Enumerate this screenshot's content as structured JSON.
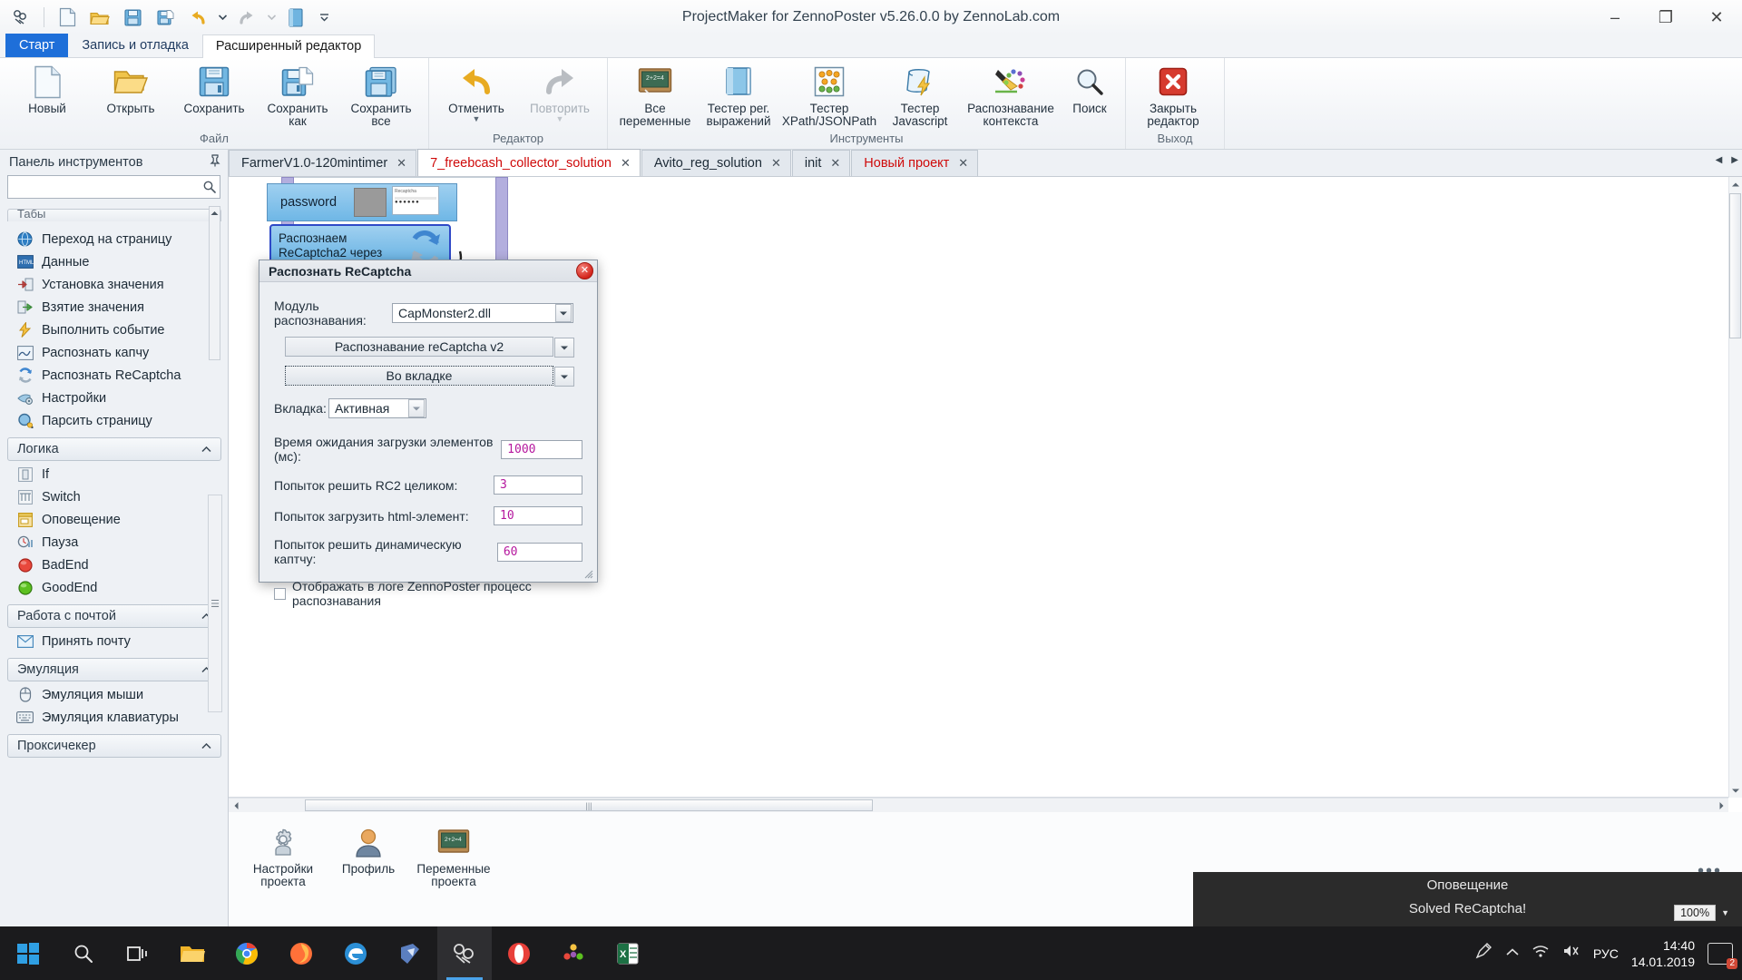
{
  "window": {
    "title": "ProjectMaker for ZennoPoster v5.26.0.0 by ZennoLab.com",
    "minimize": "–",
    "maximize": "❐",
    "close": "✕"
  },
  "quick_access": {
    "icons": [
      "zenno-logo-icon",
      "new-file-icon",
      "open-folder-icon",
      "save-icon",
      "save-as-icon",
      "undo-icon",
      "undo-dropdown-icon",
      "redo-icon",
      "redo-dropdown-icon",
      "book-icon",
      "customize-qat-icon"
    ]
  },
  "ribbon_tabs": [
    {
      "label": "Старт",
      "state": "active-blue"
    },
    {
      "label": "Запись и отладка",
      "state": "normal"
    },
    {
      "label": "Расширенный редактор",
      "state": "active-white"
    }
  ],
  "ribbon_groups": [
    {
      "title": "Файл",
      "items": [
        {
          "label": "Новый",
          "icon": "new-document-icon"
        },
        {
          "label": "Открыть",
          "icon": "open-folder-icon"
        },
        {
          "label": "Сохранить",
          "icon": "floppy-save-icon"
        },
        {
          "label": "Сохранить\nкак",
          "icon": "floppy-save-as-icon"
        },
        {
          "label": "Сохранить\nвсе",
          "icon": "floppy-save-all-icon"
        }
      ]
    },
    {
      "title": "Редактор",
      "items": [
        {
          "label": "Отменить",
          "icon": "undo-arrow-icon",
          "caret": "▼"
        },
        {
          "label": "Повторить",
          "icon": "redo-arrow-icon",
          "caret": "▼",
          "disabled": true
        }
      ]
    },
    {
      "title": "Инструменты",
      "items": [
        {
          "label": "Все\nпеременные",
          "icon": "blackboard-icon"
        },
        {
          "label": "Тестер рег.\nвыражений",
          "icon": "blue-book-icon"
        },
        {
          "label": "Тестер\nXPath/JSONPath",
          "icon": "dots-grid-icon"
        },
        {
          "label": "Тестер\nJavascript",
          "icon": "script-lightning-icon"
        },
        {
          "label": "Распознавание\nконтекста",
          "icon": "pencil-colors-icon"
        },
        {
          "label": "Поиск",
          "icon": "magnifier-icon"
        }
      ]
    },
    {
      "title": "Выход",
      "items": [
        {
          "label": "Закрыть\nредактор",
          "icon": "red-x-icon"
        }
      ]
    }
  ],
  "sidebar": {
    "title": "Панель инструментов",
    "pin_icon": "pin-icon",
    "search": {
      "value": "",
      "placeholder": "",
      "icon": "search-icon"
    },
    "clipped_group": "Табы",
    "groups": [
      {
        "label": null,
        "items": [
          {
            "label": "Переход на страницу",
            "icon": "globe-icon"
          },
          {
            "label": "Данные",
            "icon": "html-icon"
          },
          {
            "label": "Установка значения",
            "icon": "set-value-icon"
          },
          {
            "label": "Взятие значения",
            "icon": "get-value-icon"
          },
          {
            "label": "Выполнить событие",
            "icon": "lightning-icon"
          },
          {
            "label": "Распознать капчу",
            "icon": "captcha-icon"
          },
          {
            "label": "Распознать ReCaptcha",
            "icon": "recaptcha-icon"
          },
          {
            "label": "Настройки",
            "icon": "settings-icon"
          },
          {
            "label": "Парсить страницу",
            "icon": "parse-page-icon"
          }
        ]
      },
      {
        "label": "Логика",
        "collapse_icon": "chevron-up-icon",
        "items": [
          {
            "label": "If",
            "icon": "if-icon"
          },
          {
            "label": "Switch",
            "icon": "switch-icon"
          },
          {
            "label": "Оповещение",
            "icon": "notification-icon"
          },
          {
            "label": "Пауза",
            "icon": "pause-clock-icon"
          },
          {
            "label": "BadEnd",
            "icon": "red-circle-icon"
          },
          {
            "label": "GoodEnd",
            "icon": "green-circle-icon"
          }
        ]
      },
      {
        "label": "Работа с почтой",
        "collapse_icon": "chevron-up-icon",
        "items": [
          {
            "label": "Принять почту",
            "icon": "envelope-icon"
          }
        ]
      },
      {
        "label": "Эмуляция",
        "collapse_icon": "chevron-up-icon",
        "items": [
          {
            "label": "Эмуляция мыши",
            "icon": "mouse-icon"
          },
          {
            "label": "Эмуляция клавиатуры",
            "icon": "keyboard-icon"
          }
        ]
      },
      {
        "label": "Проксичекер",
        "collapse_icon": "chevron-up-icon",
        "items": []
      }
    ]
  },
  "doc_tabs": [
    {
      "label": "FarmerV1.0-120mintimer",
      "close": "✕",
      "selected": false,
      "color": "normal"
    },
    {
      "label": "7_freebcash_collector_solution",
      "close": "✕",
      "selected": true,
      "color": "red"
    },
    {
      "label": "Avito_reg_solution",
      "close": "✕",
      "selected": false,
      "color": "normal"
    },
    {
      "label": "init",
      "close": "✕",
      "selected": false,
      "color": "normal"
    },
    {
      "label": "Новый проект",
      "close": "✕",
      "selected": false,
      "color": "red"
    }
  ],
  "tab_nav": {
    "prev": "◀",
    "next": "▶"
  },
  "canvas": {
    "nodes": [
      {
        "label": "password",
        "type": "password-node"
      },
      {
        "label": "Распознаем\nReCaptcha2 через",
        "type": "recaptcha-node"
      }
    ]
  },
  "dialog": {
    "title": "Распознать ReCaptcha",
    "close_label": "✕",
    "module_label": "Модуль распознавания:",
    "module_value": "CapMonster2.dll",
    "mode_button": "Распознавание reCaptcha v2",
    "target_button": "Во вкладке",
    "tab_label": "Вкладка:",
    "tab_value": "Активная",
    "fields": [
      {
        "label": "Время ожидания загрузки элементов (мс):",
        "value": "1000"
      },
      {
        "label": "Попыток решить RC2 целиком:",
        "value": "3"
      },
      {
        "label": "Попыток загрузить html-элемент:",
        "value": "10"
      },
      {
        "label": "Попыток решить динамическую каптчу:",
        "value": "60"
      }
    ],
    "checkbox_label": "Отображать в логе ZennoPoster процесс распознавания",
    "checkbox_checked": false,
    "resize_grip": "resize-grip-icon"
  },
  "bottom_bar": {
    "items": [
      {
        "label": "Настройки\nпроекта",
        "icon": "gear-icon"
      },
      {
        "label": "Профиль",
        "icon": "profile-user-icon"
      },
      {
        "label": "Переменные\nпроекта",
        "icon": "blackboard-icon"
      }
    ],
    "overflow": "•••"
  },
  "toast": {
    "title": "Оповещение",
    "message": "Solved ReCaptcha!",
    "zoom": "100%",
    "zoom_caret": "▼"
  },
  "taskbar": {
    "start_icon": "windows-start-icon",
    "search_icon": "search-icon",
    "taskview_icon": "task-view-icon",
    "apps": [
      {
        "icon": "file-explorer-icon",
        "active": false
      },
      {
        "icon": "chrome-icon",
        "active": false
      },
      {
        "icon": "firefox-icon",
        "active": false
      },
      {
        "icon": "edge-icon",
        "active": false
      },
      {
        "icon": "blue-app-icon",
        "active": false
      },
      {
        "icon": "zennoposter-icon",
        "active": true
      },
      {
        "icon": "opera-icon",
        "active": false
      },
      {
        "icon": "colorful-app-icon",
        "active": false
      },
      {
        "icon": "excel-icon",
        "active": false
      }
    ],
    "tray": {
      "pen_icon": "pen-tablet-icon",
      "chevron_icon": "show-hidden-icons-icon",
      "network_icon": "wifi-icon",
      "volume_icon": "volume-icon",
      "language": "РУС",
      "time": "14:40",
      "date": "14.01.2019",
      "notification_icon": "action-center-icon",
      "notification_count": "2"
    }
  },
  "colors": {
    "accent": "#1e6fd9",
    "tab_red": "#cf0a0a",
    "field_text": "#b5179e",
    "node_border": "#2f49c7",
    "toast_bg": "#2b2b2b"
  }
}
